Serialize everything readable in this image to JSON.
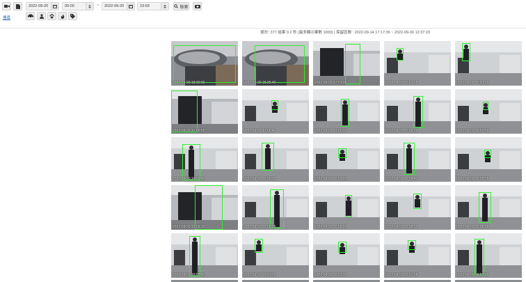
{
  "toolbar": {
    "start_date": "2022-09-20",
    "start_time": "00:00",
    "range_separator": "~",
    "end_date": "2022-09-20",
    "end_time": "23:59",
    "search_label": "檢索",
    "left_link": "搜尋"
  },
  "summary": {
    "text": "統計: 377 結果 0.2 秒 (最多顯示筆數 1000) | 保留區間 : 2022-09-14 17:17:36 ~ 2022-09-30 12:37:23"
  },
  "thumbnails": [
    {
      "timestamp": "2022-09-20 18:30:00",
      "scene": "chair"
    },
    {
      "timestamp": "2022-09-20 18:25:40",
      "scene": "chair"
    },
    {
      "timestamp": "2022-09-20 17:01:09",
      "scene": "office-close"
    },
    {
      "timestamp": "2022-09-20 17:01:05",
      "scene": "office"
    },
    {
      "timestamp": "2022-09-20 17:01:02",
      "scene": "office"
    },
    {
      "timestamp": "2022-09-20 17:00:55",
      "scene": "office-close"
    },
    {
      "timestamp": "2022-09-20 17:00:46",
      "scene": "office"
    },
    {
      "timestamp": "2022-09-20 17:00:39",
      "scene": "office"
    },
    {
      "timestamp": "2022-09-20 17:00:02",
      "scene": "office"
    },
    {
      "timestamp": "2022-09-20 16:59:59",
      "scene": "office"
    },
    {
      "timestamp": "2022-09-20 16:59:42",
      "scene": "office"
    },
    {
      "timestamp": "2022-09-20 16:59:35",
      "scene": "office"
    },
    {
      "timestamp": "2022-09-20 16:59:22",
      "scene": "office"
    },
    {
      "timestamp": "2022-09-20 16:58:49",
      "scene": "office"
    },
    {
      "timestamp": "2022-09-20 16:58:35",
      "scene": "office"
    },
    {
      "timestamp": "2022-09-20 16:58:32",
      "scene": "office-close"
    },
    {
      "timestamp": "2022-09-20 16:58:25",
      "scene": "office"
    },
    {
      "timestamp": "2022-09-20 16:58:22",
      "scene": "office"
    },
    {
      "timestamp": "2022-09-20 16:58:15",
      "scene": "office"
    },
    {
      "timestamp": "2022-09-20 16:58:02",
      "scene": "office"
    },
    {
      "timestamp": "2022-09-20 16:57:42",
      "scene": "office"
    },
    {
      "timestamp": "2022-09-20 16:57:25",
      "scene": "office"
    },
    {
      "timestamp": "2022-09-20 16:57:15",
      "scene": "office"
    },
    {
      "timestamp": "2022-09-20 16:57:05",
      "scene": "office"
    },
    {
      "timestamp": "2022-09-20 16:57:02",
      "scene": "office"
    }
  ],
  "icons": {
    "video": "video-camera-icon",
    "document": "document-icon",
    "calendar": "calendar-icon",
    "search": "search-icon",
    "camera": "camera-icon",
    "car": "car-icon",
    "person": "person-icon",
    "pet": "paw-icon",
    "fire": "fire-icon",
    "tag": "tag-icon"
  },
  "colors": {
    "detection_box": "#2ef02e",
    "link": "#1a5fb4"
  }
}
